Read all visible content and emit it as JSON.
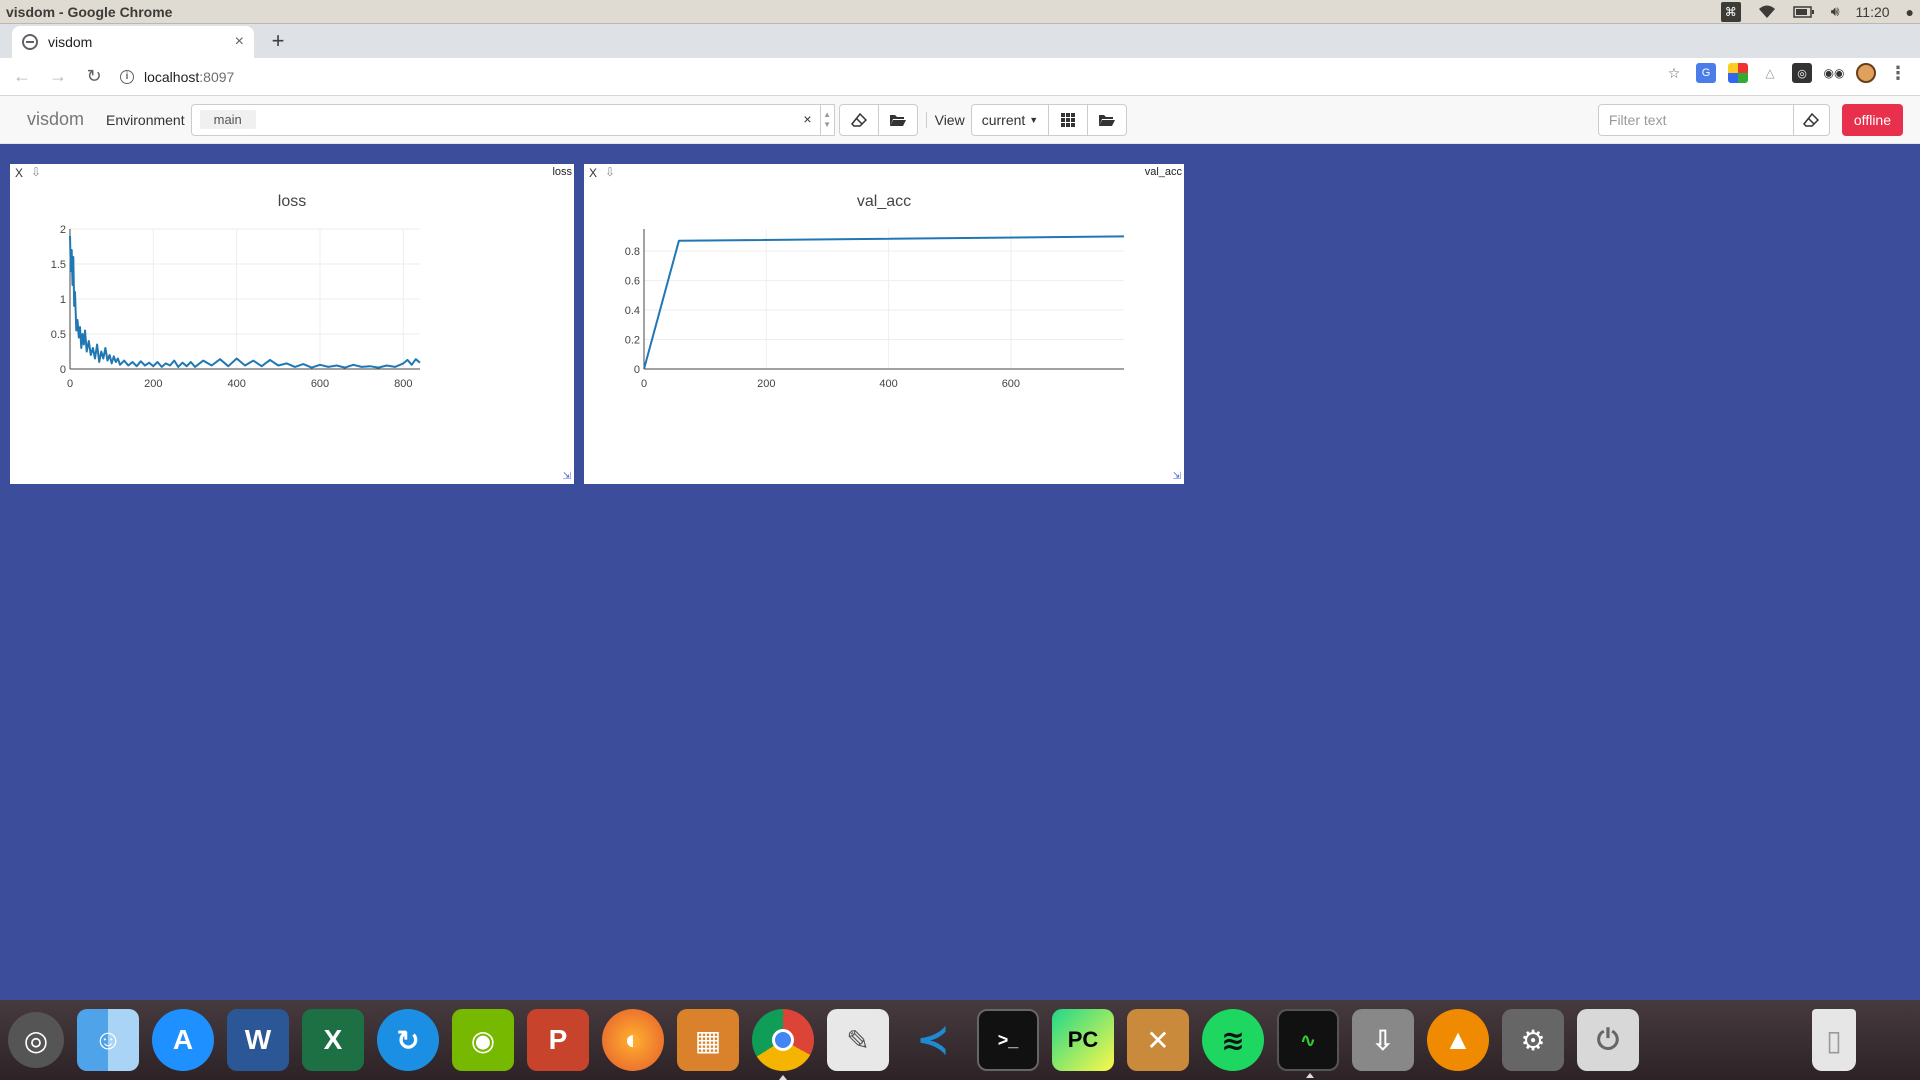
{
  "os": {
    "window_title": "visdom - Google Chrome",
    "clock": "11:20"
  },
  "browser": {
    "tab_title": "visdom",
    "url_host": "localhost",
    "url_port": ":8097"
  },
  "visdom": {
    "brand": "visdom",
    "environment_label": "Environment",
    "environment_selected": "main",
    "view_label": "View",
    "view_selected": "current",
    "filter_placeholder": "Filter text",
    "status_button": "offline"
  },
  "panes": [
    {
      "close": "X",
      "title_label": "loss"
    },
    {
      "close": "X",
      "title_label": "val_acc"
    }
  ],
  "chart_data": [
    {
      "type": "line",
      "title": "loss",
      "xlabel": "",
      "ylabel": "",
      "xlim": [
        0,
        840
      ],
      "ylim": [
        0,
        2
      ],
      "x_ticks": [
        0,
        200,
        400,
        600,
        800
      ],
      "y_ticks": [
        0,
        0.5,
        1,
        1.5,
        2
      ],
      "grid": true,
      "color": "#1f77b4",
      "series": [
        {
          "x": [
            0,
            2,
            4,
            6,
            8,
            10,
            12,
            15,
            18,
            21,
            24,
            27,
            30,
            33,
            36,
            40,
            45,
            50,
            55,
            60,
            65,
            70,
            75,
            80,
            85,
            90,
            95,
            100,
            105,
            110,
            115,
            120,
            130,
            140,
            150,
            160,
            170,
            180,
            190,
            200,
            210,
            220,
            230,
            240,
            250,
            260,
            270,
            280,
            290,
            300,
            320,
            340,
            360,
            380,
            400,
            420,
            440,
            460,
            480,
            500,
            520,
            540,
            560,
            580,
            600,
            620,
            640,
            660,
            680,
            700,
            720,
            740,
            760,
            780,
            800,
            810,
            820,
            830,
            840
          ],
          "y": [
            1.9,
            1.4,
            1.7,
            1.2,
            1.6,
            0.9,
            1.1,
            0.55,
            0.7,
            0.45,
            0.6,
            0.3,
            0.5,
            0.35,
            0.55,
            0.25,
            0.4,
            0.2,
            0.3,
            0.15,
            0.35,
            0.1,
            0.25,
            0.15,
            0.3,
            0.12,
            0.2,
            0.08,
            0.18,
            0.1,
            0.15,
            0.06,
            0.12,
            0.05,
            0.1,
            0.04,
            0.11,
            0.05,
            0.09,
            0.04,
            0.1,
            0.03,
            0.08,
            0.05,
            0.12,
            0.03,
            0.09,
            0.04,
            0.1,
            0.03,
            0.12,
            0.05,
            0.14,
            0.04,
            0.15,
            0.05,
            0.12,
            0.04,
            0.13,
            0.05,
            0.08,
            0.03,
            0.07,
            0.02,
            0.06,
            0.03,
            0.05,
            0.02,
            0.06,
            0.03,
            0.04,
            0.02,
            0.05,
            0.03,
            0.08,
            0.13,
            0.06,
            0.14,
            0.09
          ]
        }
      ]
    },
    {
      "type": "line",
      "title": "val_acc",
      "xlabel": "",
      "ylabel": "",
      "xlim": [
        0,
        785
      ],
      "ylim": [
        0,
        0.95
      ],
      "x_ticks": [
        0,
        200,
        400,
        600
      ],
      "y_ticks": [
        0,
        0.2,
        0.4,
        0.6,
        0.8
      ],
      "grid": true,
      "color": "#1f77b4",
      "series": [
        {
          "x": [
            0,
            57,
            785
          ],
          "y": [
            0,
            0.87,
            0.9
          ]
        }
      ]
    }
  ],
  "dock": {
    "icons": [
      "ubuntu-icon",
      "finder-icon",
      "app-store-icon",
      "word-icon",
      "excel-icon",
      "sync-icon",
      "nvidia-icon",
      "powerpoint-icon",
      "firefox-icon",
      "calculator-icon",
      "chrome-icon",
      "text-editor-icon",
      "vscode-icon",
      "terminal-icon",
      "pycharm-icon",
      "toolbox-icon",
      "spotify-icon",
      "system-monitor-icon",
      "usb-drive-icon",
      "vlc-icon",
      "settings-icon",
      "power-icon",
      "trash-icon"
    ]
  }
}
